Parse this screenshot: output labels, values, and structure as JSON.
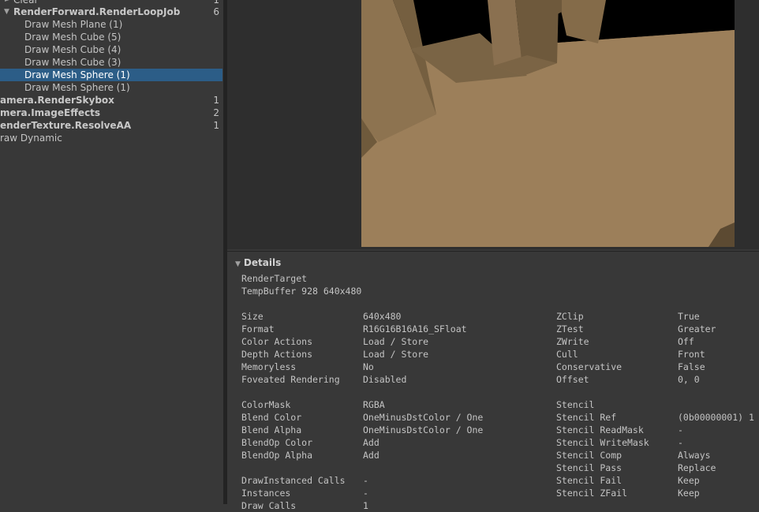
{
  "hierarchy": {
    "rows": [
      {
        "label": "Clear",
        "count": "1"
      },
      {
        "label": "RenderForward.RenderLoopJob",
        "count": "6"
      },
      {
        "label": "Draw Mesh Plane (1)",
        "count": ""
      },
      {
        "label": "Draw Mesh Cube (5)",
        "count": ""
      },
      {
        "label": "Draw Mesh Cube (4)",
        "count": ""
      },
      {
        "label": "Draw Mesh Cube (3)",
        "count": ""
      },
      {
        "label": "Draw Mesh Sphere (1)",
        "count": ""
      },
      {
        "label": "Draw Mesh Sphere (1)",
        "count": ""
      },
      {
        "label": "amera.RenderSkybox",
        "count": "1"
      },
      {
        "label": "mera.ImageEffects",
        "count": "2"
      },
      {
        "label": "enderTexture.ResolveAA",
        "count": "1"
      },
      {
        "label": "raw Dynamic",
        "count": ""
      }
    ]
  },
  "details": {
    "title": "Details",
    "render_target_label": "RenderTarget",
    "render_target_value": "TempBuffer 928 640x480",
    "left_props": [
      {
        "name": "Size",
        "value": "640x480"
      },
      {
        "name": "Format",
        "value": "R16G16B16A16_SFloat"
      },
      {
        "name": "Color Actions",
        "value": "Load / Store"
      },
      {
        "name": "Depth Actions",
        "value": "Load / Store"
      },
      {
        "name": "Memoryless",
        "value": "No"
      },
      {
        "name": "Foveated Rendering",
        "value": "Disabled"
      },
      {
        "name": "ColorMask",
        "value": "RGBA"
      },
      {
        "name": "Blend Color",
        "value": "OneMinusDstColor / One"
      },
      {
        "name": "Blend Alpha",
        "value": "OneMinusDstColor / One"
      },
      {
        "name": "BlendOp Color",
        "value": "Add"
      },
      {
        "name": "BlendOp Alpha",
        "value": "Add"
      },
      {
        "name": "DrawInstanced Calls",
        "value": "-"
      },
      {
        "name": "Instances",
        "value": "-"
      },
      {
        "name": "Draw Calls",
        "value": "1"
      }
    ],
    "right_props": [
      {
        "name": "ZClip",
        "value": "True"
      },
      {
        "name": "ZTest",
        "value": "Greater"
      },
      {
        "name": "ZWrite",
        "value": "Off"
      },
      {
        "name": "Cull",
        "value": "Front"
      },
      {
        "name": "Conservative",
        "value": "False"
      },
      {
        "name": "Offset",
        "value": "0, 0"
      },
      {
        "name": "Stencil",
        "value": ""
      },
      {
        "name": "Stencil Ref",
        "value": "(0b00000001) 1"
      },
      {
        "name": "Stencil ReadMask",
        "value": "-"
      },
      {
        "name": "Stencil WriteMask",
        "value": "-"
      },
      {
        "name": "Stencil Comp",
        "value": "Always"
      },
      {
        "name": "Stencil Pass",
        "value": "Replace"
      },
      {
        "name": "Stencil Fail",
        "value": "Keep"
      },
      {
        "name": "Stencil ZFail",
        "value": "Keep"
      }
    ]
  },
  "colors": {
    "selection": "#2c5d87",
    "panel_bg": "#383838",
    "floor": "#9a7d58",
    "cube_front": "#8e7450",
    "cube_side": "#6f5a3c",
    "sky": "#000000"
  },
  "icons": {
    "expand": "triangle-down-icon"
  }
}
